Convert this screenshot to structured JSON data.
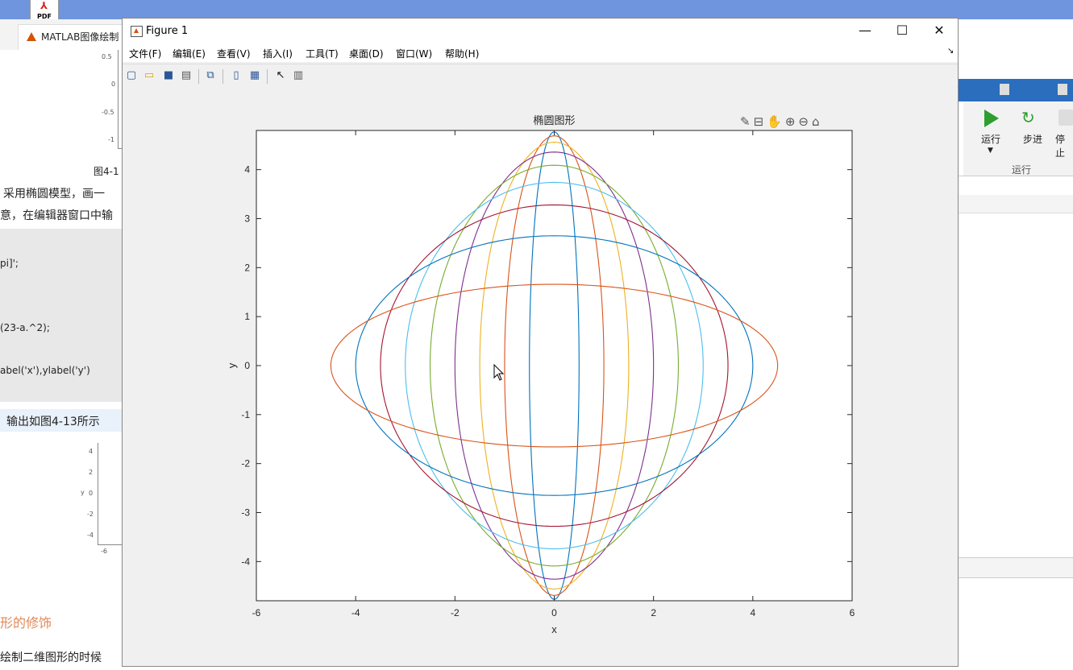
{
  "background": {
    "pdf_badge": "PDF",
    "browser_tab": "MATLAB图像绘制",
    "doc": {
      "figure_caption": "图4-1",
      "line1": "采用椭圆模型，画一",
      "line2": "意，在编辑器窗口中输",
      "code1": "pi]';",
      "code2": "(23-a.^2);",
      "code3": "abel('x'),ylabel('y')",
      "line3": "输出如图4-13所示",
      "heading": "形的修饰",
      "line4": "绘制二维图形的时候",
      "mini_ticks_top": [
        "0.5",
        "0",
        "-0.5",
        "-1"
      ],
      "mini_ticks_bottom": [
        "4",
        "2",
        "0",
        "-2",
        "-4"
      ],
      "mini_ylabel": "y",
      "mini_xtick": "-6"
    },
    "right_panel": {
      "run": "运行",
      "step": "步进",
      "stop": "停止",
      "section": "运行"
    }
  },
  "window": {
    "title": "Figure 1",
    "menu": [
      "文件(F)",
      "编辑(E)",
      "查看(V)",
      "插入(I)",
      "工具(T)",
      "桌面(D)",
      "窗口(W)",
      "帮助(H)"
    ],
    "toolbar_icons": [
      "new-figure-icon",
      "open-icon",
      "save-icon",
      "print-icon",
      "link-icon",
      "colorbar-icon",
      "legend-icon",
      "pointer-icon",
      "property-editor-icon"
    ],
    "axes_toolbar_icons": [
      "brush-icon",
      "data-tip-icon",
      "pan-icon",
      "zoom-in-icon",
      "zoom-out-icon",
      "home-icon"
    ]
  },
  "chart_data": {
    "type": "line",
    "title": "椭圆图形",
    "xlabel": "x",
    "ylabel": "y",
    "xlim": [
      -6,
      6
    ],
    "ylim": [
      -4.8,
      4.8
    ],
    "xticks": [
      -6,
      -4,
      -2,
      0,
      2,
      4,
      6
    ],
    "yticks": [
      -4,
      -3,
      -2,
      -1,
      0,
      1,
      2,
      3,
      4
    ],
    "grid": false,
    "series": [
      {
        "a": 0.5,
        "b": 4.77,
        "color": "#0072BD"
      },
      {
        "a": 1.0,
        "b": 4.69,
        "color": "#D95319"
      },
      {
        "a": 1.5,
        "b": 4.56,
        "color": "#EDB120"
      },
      {
        "a": 2.0,
        "b": 4.36,
        "color": "#7E2F8E"
      },
      {
        "a": 2.5,
        "b": 4.09,
        "color": "#77AC30"
      },
      {
        "a": 3.0,
        "b": 3.74,
        "color": "#4DBEEE"
      },
      {
        "a": 3.5,
        "b": 3.28,
        "color": "#A2142F"
      },
      {
        "a": 4.0,
        "b": 2.65,
        "color": "#0072BD"
      },
      {
        "a": 4.5,
        "b": 1.66,
        "color": "#D95319"
      }
    ]
  }
}
